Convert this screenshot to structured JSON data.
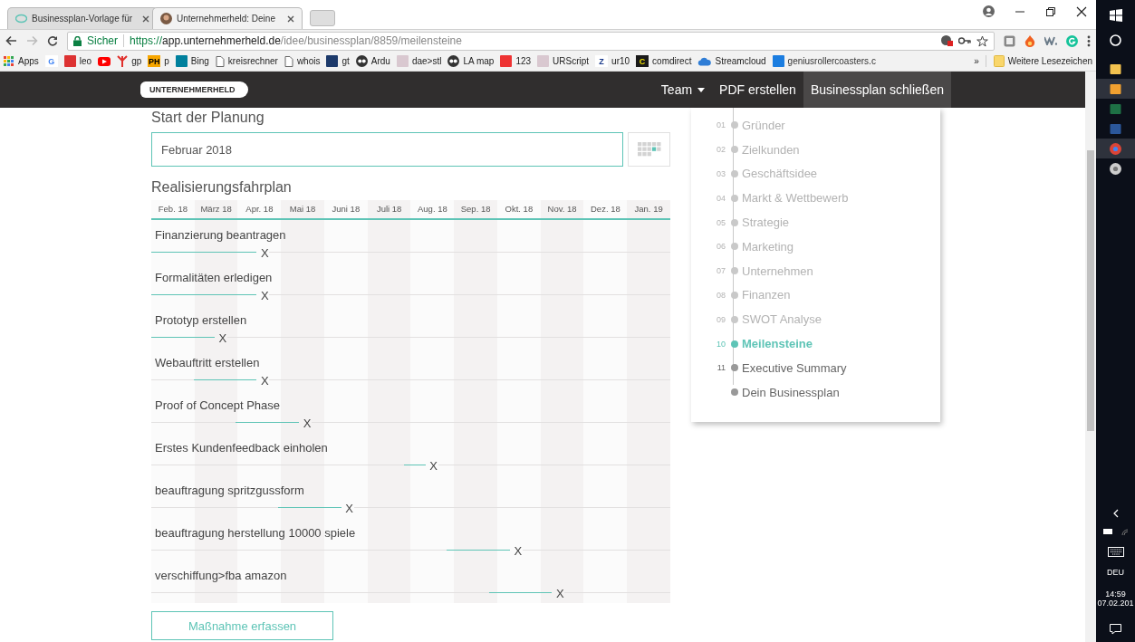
{
  "browser": {
    "tabs": [
      {
        "title": "Businessplan-Vorlage für",
        "selected": false
      },
      {
        "title": "Unternehmerheld: Deine",
        "selected": true
      }
    ],
    "address": {
      "security": "Sicher",
      "url_scheme": "https://",
      "url_host": "app.unternehmerheld.de",
      "url_path": "/idee/businessplan/8859/meilensteine"
    },
    "bookmarks": [
      {
        "kind": "apps",
        "label": "Apps"
      },
      {
        "kind": "google",
        "badge": "G"
      },
      {
        "kind": "flag",
        "label": "leo"
      },
      {
        "kind": "youtube"
      },
      {
        "kind": "person",
        "label": "gp"
      },
      {
        "kind": "orange",
        "badge": "PH",
        "label": "p"
      },
      {
        "kind": "teal",
        "label": "Bing"
      },
      {
        "kind": "page",
        "label": "kreisrechner"
      },
      {
        "kind": "page",
        "label": "whois"
      },
      {
        "kind": "navy",
        "label": "gt"
      },
      {
        "kind": "circle",
        "label": "Ardu"
      },
      {
        "kind": "pale",
        "label": "dae>stl"
      },
      {
        "kind": "circle",
        "label": "LA map"
      },
      {
        "kind": "red",
        "label": "123"
      },
      {
        "kind": "pale",
        "label": "URScript"
      },
      {
        "kind": "letter",
        "badge": "Z",
        "label": "ur10"
      },
      {
        "kind": "yellow",
        "badge": "C",
        "label": "comdirect"
      },
      {
        "kind": "cloud",
        "label": "Streamcloud"
      },
      {
        "kind": "blue",
        "label": "geniusrollercoasters.c"
      }
    ],
    "more": "»",
    "other_bookmarks": "Weitere Lesezeichen"
  },
  "header": {
    "logo": "UNTERNEHMERHELD",
    "nav": [
      {
        "label": "Team",
        "dropdown": true,
        "selected": false
      },
      {
        "label": "PDF erstellen",
        "dropdown": false,
        "selected": false
      },
      {
        "label": "Businessplan schließen",
        "dropdown": false,
        "selected": true
      }
    ]
  },
  "planning": {
    "title": "Start der Planung",
    "value": "Februar 2018"
  },
  "roadmap": {
    "title": "Realisierungsfahrplan",
    "months": [
      "Feb. 18",
      "März 18",
      "Apr. 18",
      "Mai 18",
      "Juni 18",
      "Juli 18",
      "Aug. 18",
      "Sep. 18",
      "Okt. 18",
      "Nov. 18",
      "Dez. 18",
      "Jan. 19"
    ],
    "measures": [
      {
        "label": "Finanzierung beantragen",
        "delete": "X",
        "half_months": [
          true,
          true,
          true,
          true,
          true,
          false,
          false,
          false,
          false,
          false,
          false,
          false,
          false,
          false,
          false,
          false,
          false,
          false,
          false,
          false,
          false,
          false,
          false,
          false
        ]
      },
      {
        "label": "Formalitäten erledigen",
        "delete": "X",
        "half_months": [
          true,
          true,
          true,
          true,
          true,
          false,
          false,
          false,
          false,
          false,
          false,
          false,
          false,
          false,
          false,
          false,
          false,
          false,
          false,
          false,
          false,
          false,
          false,
          false
        ]
      },
      {
        "label": "Prototyp erstellen",
        "delete": "X",
        "half_months": [
          true,
          true,
          true,
          false,
          false,
          false,
          false,
          false,
          false,
          false,
          false,
          false,
          false,
          false,
          false,
          false,
          false,
          false,
          false,
          false,
          false,
          false,
          false,
          false
        ]
      },
      {
        "label": "Webauftritt erstellen",
        "delete": "X",
        "half_months": [
          false,
          false,
          true,
          true,
          true,
          false,
          false,
          false,
          false,
          false,
          false,
          false,
          false,
          false,
          false,
          false,
          false,
          false,
          false,
          false,
          false,
          false,
          false,
          false
        ]
      },
      {
        "label": "Proof of Concept Phase",
        "delete": "X",
        "half_months": [
          false,
          false,
          false,
          false,
          true,
          true,
          true,
          false,
          false,
          false,
          false,
          false,
          false,
          false,
          false,
          false,
          false,
          false,
          false,
          false,
          false,
          false,
          false,
          false
        ]
      },
      {
        "label": "Erstes Kundenfeedback einholen",
        "delete": "X",
        "half_months": [
          false,
          false,
          false,
          false,
          false,
          false,
          false,
          false,
          false,
          false,
          false,
          false,
          true,
          false,
          false,
          false,
          false,
          false,
          false,
          false,
          false,
          false,
          false,
          false
        ]
      },
      {
        "label": "beauftragung spritzgussform",
        "delete": "X",
        "half_months": [
          false,
          false,
          false,
          false,
          false,
          false,
          true,
          true,
          true,
          false,
          false,
          false,
          false,
          false,
          false,
          false,
          false,
          false,
          false,
          false,
          false,
          false,
          false,
          false
        ]
      },
      {
        "label": "beauftragung herstellung 10000 spiele",
        "delete": "X",
        "half_months": [
          false,
          false,
          false,
          false,
          false,
          false,
          false,
          false,
          false,
          false,
          false,
          false,
          false,
          false,
          true,
          true,
          true,
          false,
          false,
          false,
          false,
          false,
          false,
          false
        ]
      },
      {
        "label": "verschiffung>fba amazon",
        "delete": "X",
        "half_months": [
          false,
          false,
          false,
          false,
          false,
          false,
          false,
          false,
          false,
          false,
          false,
          false,
          false,
          false,
          false,
          false,
          true,
          true,
          true,
          false,
          false,
          false,
          false,
          false
        ]
      }
    ],
    "add_button": "Maßnahme erfassen"
  },
  "steps": [
    {
      "number": "01",
      "label": "Gründer",
      "completed": true,
      "selected": false
    },
    {
      "number": "02",
      "label": "Zielkunden",
      "completed": true,
      "selected": false
    },
    {
      "number": "03",
      "label": "Geschäftsidee",
      "completed": true,
      "selected": false
    },
    {
      "number": "04",
      "label": "Markt & Wettbewerb",
      "completed": true,
      "selected": false
    },
    {
      "number": "05",
      "label": "Strategie",
      "completed": true,
      "selected": false
    },
    {
      "number": "06",
      "label": "Marketing",
      "completed": true,
      "selected": false
    },
    {
      "number": "07",
      "label": "Unternehmen",
      "completed": true,
      "selected": false
    },
    {
      "number": "08",
      "label": "Finanzen",
      "completed": true,
      "selected": false
    },
    {
      "number": "09",
      "label": "SWOT Analyse",
      "completed": true,
      "selected": false
    },
    {
      "number": "10",
      "label": "Meilensteine",
      "completed": false,
      "selected": true
    },
    {
      "number": "11",
      "label": "Executive Summary",
      "completed": false,
      "selected": false
    },
    {
      "label": "Dein Businessplan",
      "completed": false,
      "selected": false
    }
  ],
  "taskbar": {
    "apps": [
      {
        "kind": "explorer",
        "selected": false
      },
      {
        "kind": "remote",
        "selected": true
      },
      {
        "kind": "excel",
        "selected": false
      },
      {
        "kind": "word",
        "selected": false
      },
      {
        "kind": "chrome",
        "selected": true
      },
      {
        "kind": "globe",
        "selected": false
      }
    ],
    "language": "DEU",
    "time": "14:59",
    "date": "07.02.201"
  }
}
